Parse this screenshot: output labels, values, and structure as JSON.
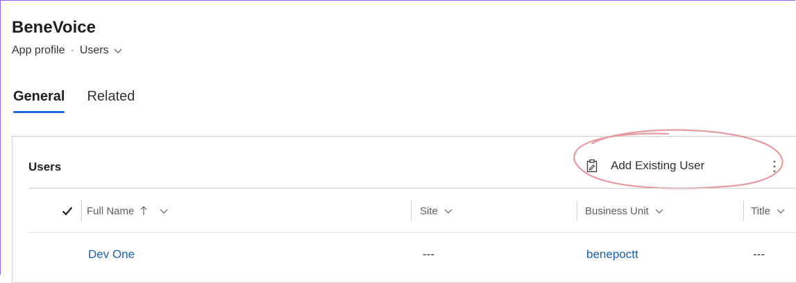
{
  "header": {
    "app_title": "BeneVoice",
    "breadcrumb": {
      "entity": "App profile",
      "separator": "·",
      "view": "Users"
    }
  },
  "tabs": [
    {
      "label": "General",
      "active": true
    },
    {
      "label": "Related",
      "active": false
    }
  ],
  "subgrid": {
    "title": "Users",
    "add_button_label": "Add Existing User",
    "columns": {
      "full_name": "Full Name",
      "site": "Site",
      "business_unit": "Business Unit",
      "title": "Title"
    },
    "rows": [
      {
        "full_name": "Dev One",
        "site": "---",
        "business_unit": "benepoctt",
        "title": "---"
      }
    ]
  },
  "colors": {
    "accent": "#2266e3",
    "link": "#1b5fa8",
    "highlight": "#e2878e",
    "frame": "#8a5cf6"
  }
}
